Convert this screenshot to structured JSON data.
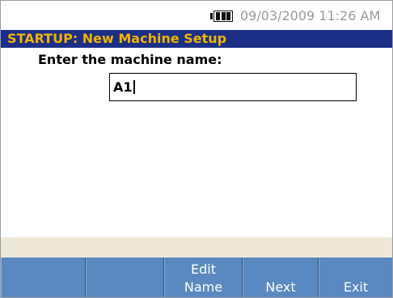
{
  "status": {
    "datetime": "09/03/2009 11:26 AM",
    "battery_icon": "battery-icon"
  },
  "title": "STARTUP: New Machine Setup",
  "form": {
    "prompt": "Enter the machine name:",
    "machine_name_value": "A1"
  },
  "softkeys": [
    {
      "line1": "",
      "line2": ""
    },
    {
      "line1": "",
      "line2": ""
    },
    {
      "line1": "Edit",
      "line2": "Name"
    },
    {
      "line1": "",
      "line2": "Next"
    },
    {
      "line1": "",
      "line2": "Exit"
    }
  ],
  "colors": {
    "title_bar": "#1c2f86",
    "title_text": "#f2b300",
    "softkey_bar": "#5a88c0",
    "footer_strip": "#ece9d8",
    "datetime_text": "#9a9a9a"
  }
}
